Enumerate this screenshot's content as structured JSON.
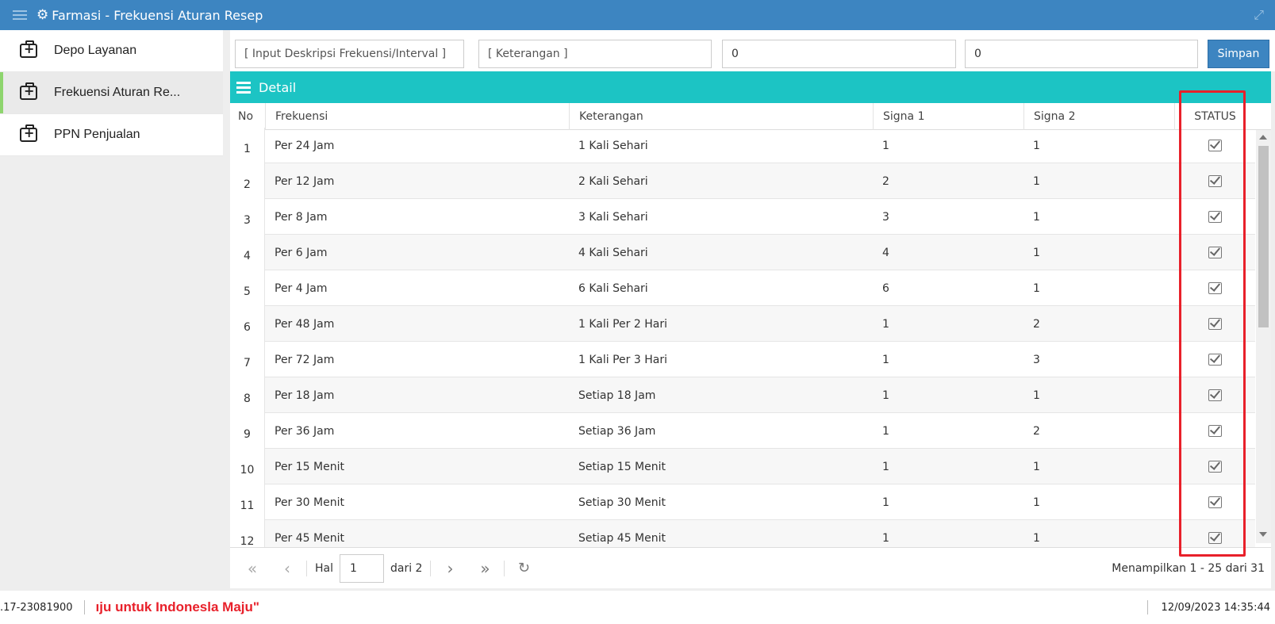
{
  "window": {
    "title": "Farmasi - Frekuensi Aturan Resep"
  },
  "sidebar": {
    "items": [
      {
        "label": "Depo Layanan",
        "active": false
      },
      {
        "label": "Frekuensi Aturan Re...",
        "active": true
      },
      {
        "label": "PPN Penjualan",
        "active": false
      }
    ]
  },
  "form": {
    "deskripsi_placeholder": "[ Input Deskripsi Frekuensi/Interval ]",
    "keterangan_placeholder": "[ Keterangan ]",
    "signa1_value": "0",
    "signa2_value": "0",
    "save_label": "Simpan"
  },
  "detail": {
    "title": "Detail",
    "columns": [
      "No",
      "Frekuensi",
      "Keterangan",
      "Signa 1",
      "Signa 2",
      "STATUS"
    ],
    "rows": [
      {
        "no": "1",
        "frekuensi": "Per 24 Jam",
        "keterangan": "1 Kali Sehari",
        "signa1": "1",
        "signa2": "1",
        "status": true
      },
      {
        "no": "2",
        "frekuensi": "Per 12 Jam",
        "keterangan": "2 Kali Sehari",
        "signa1": "2",
        "signa2": "1",
        "status": true
      },
      {
        "no": "3",
        "frekuensi": "Per 8 Jam",
        "keterangan": "3 Kali Sehari",
        "signa1": "3",
        "signa2": "1",
        "status": true
      },
      {
        "no": "4",
        "frekuensi": "Per 6 Jam",
        "keterangan": "4 Kali Sehari",
        "signa1": "4",
        "signa2": "1",
        "status": true
      },
      {
        "no": "5",
        "frekuensi": "Per 4 Jam",
        "keterangan": "6 Kali Sehari",
        "signa1": "6",
        "signa2": "1",
        "status": true
      },
      {
        "no": "6",
        "frekuensi": "Per 48 Jam",
        "keterangan": "1 Kali Per 2 Hari",
        "signa1": "1",
        "signa2": "2",
        "status": true
      },
      {
        "no": "7",
        "frekuensi": "Per 72 Jam",
        "keterangan": "1 Kali Per 3 Hari",
        "signa1": "1",
        "signa2": "3",
        "status": true
      },
      {
        "no": "8",
        "frekuensi": "Per 18 Jam",
        "keterangan": "Setiap 18 Jam",
        "signa1": "1",
        "signa2": "1",
        "status": true
      },
      {
        "no": "9",
        "frekuensi": "Per 36 Jam",
        "keterangan": "Setiap 36 Jam",
        "signa1": "1",
        "signa2": "2",
        "status": true
      },
      {
        "no": "10",
        "frekuensi": "Per 15 Menit",
        "keterangan": "Setiap 15 Menit",
        "signa1": "1",
        "signa2": "1",
        "status": true
      },
      {
        "no": "11",
        "frekuensi": "Per 30 Menit",
        "keterangan": "Setiap 30 Menit",
        "signa1": "1",
        "signa2": "1",
        "status": true
      },
      {
        "no": "12",
        "frekuensi": "Per 45 Menit",
        "keterangan": "Setiap 45 Menit",
        "signa1": "1",
        "signa2": "1",
        "status": true
      }
    ]
  },
  "pager": {
    "page_label": "Hal",
    "page_value": "1",
    "of_label": "dari 2",
    "info": "Menampilkan 1 - 25 dari 31"
  },
  "statusbar": {
    "version": ".17-23081900",
    "marquee": "ıju untuk Indonesla Maju\"",
    "datetime": "12/09/2023 14:35:44"
  },
  "colors": {
    "titlebar": "#3d85c1",
    "detail_bar": "#1cc4c4",
    "highlight": "#e8202a",
    "active_marker": "#8ed56e"
  }
}
